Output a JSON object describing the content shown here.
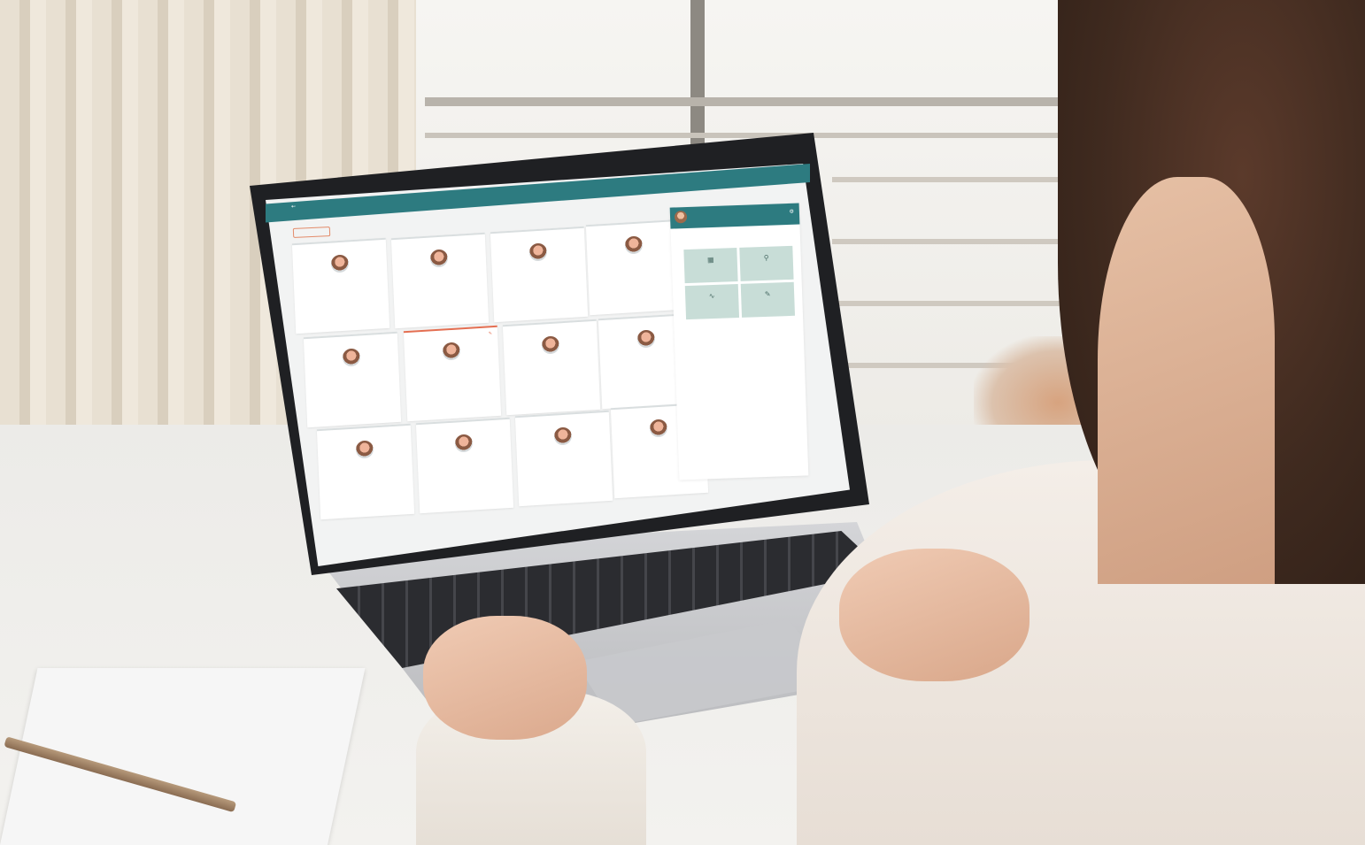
{
  "app": {
    "title": "",
    "help_link": "",
    "filter_chip": "",
    "footer": ""
  },
  "cards": [
    {
      "name": "",
      "role": "",
      "foot": ""
    },
    {
      "name": "",
      "role": "",
      "foot": ""
    },
    {
      "name": "",
      "role": "",
      "foot": ""
    },
    {
      "name": "",
      "role": "",
      "foot": ""
    },
    {
      "name": "",
      "role": "",
      "foot": ""
    },
    {
      "name": "",
      "role": "",
      "foot": "",
      "active": true
    },
    {
      "name": "",
      "role": "",
      "foot": ""
    },
    {
      "name": "",
      "role": "",
      "foot": ""
    },
    {
      "name": "",
      "role": "",
      "foot": ""
    },
    {
      "name": "",
      "role": "",
      "foot": ""
    },
    {
      "name": "",
      "role": "",
      "foot": ""
    },
    {
      "name": "",
      "role": "",
      "foot": ""
    }
  ],
  "panel": {
    "name": "",
    "subtitle": "",
    "label": "",
    "tiles": [
      {
        "label": "",
        "icon": "calendar-icon"
      },
      {
        "label": "",
        "icon": "search-icon"
      },
      {
        "label": "",
        "icon": "activity-icon"
      },
      {
        "label": "",
        "icon": "edit-icon"
      }
    ]
  },
  "colors": {
    "accent": "#2d7b80",
    "highlight": "#e46f52",
    "tile": "#c8ddd7"
  }
}
